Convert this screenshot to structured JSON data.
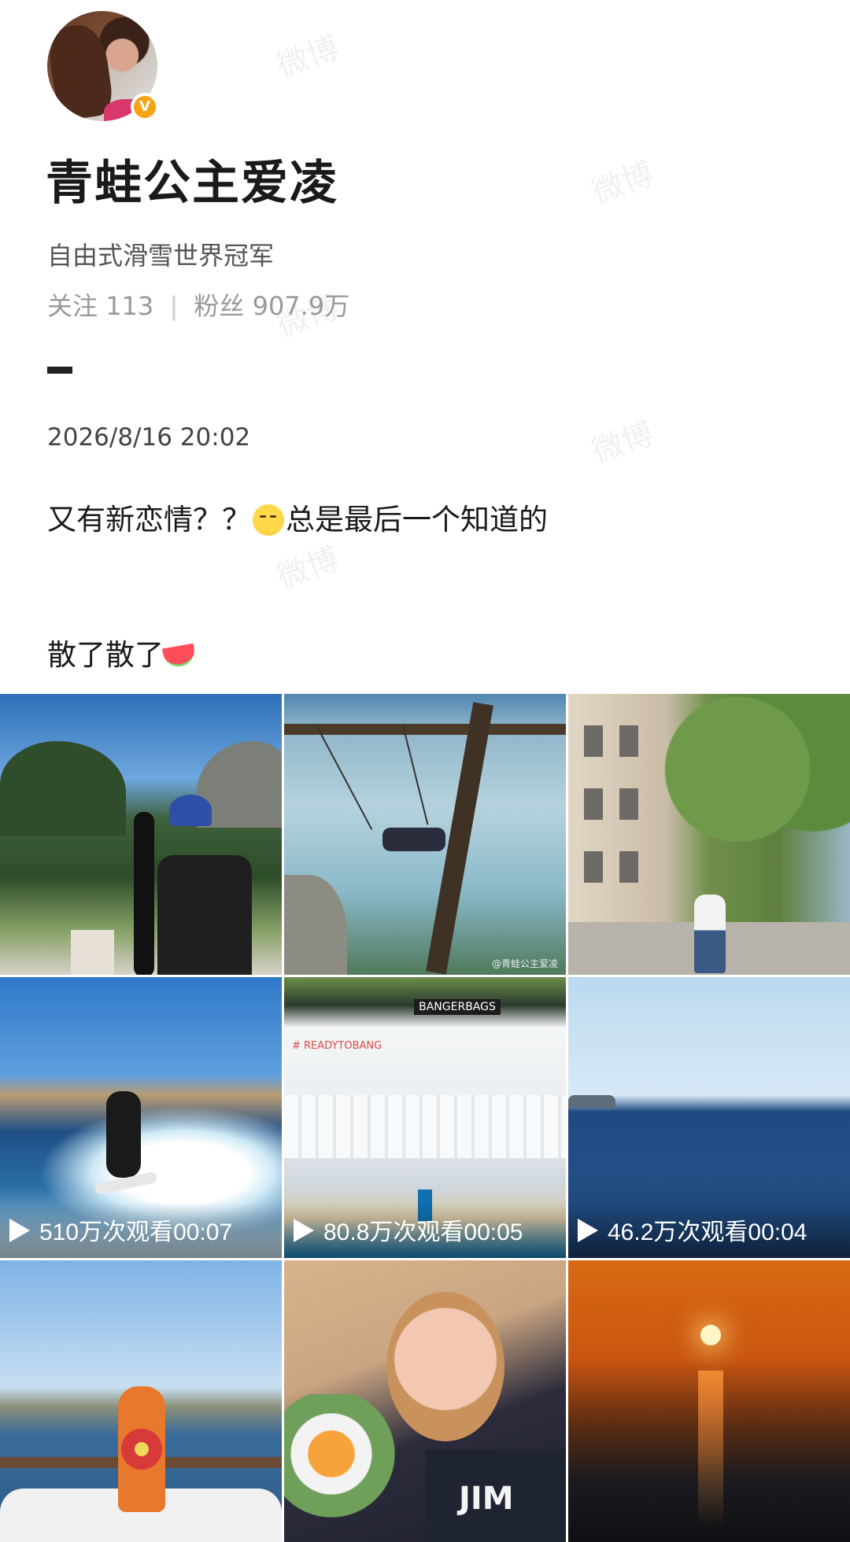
{
  "watermark": "微博",
  "profile": {
    "name": "青蛙公主爱凌",
    "bio": "自由式滑雪世界冠军",
    "following_label": "关注",
    "following_count": "113",
    "followers_label": "粉丝",
    "followers_count": "907.9万"
  },
  "post": {
    "timestamp": "2026/8/16 20:02",
    "line1_a": "又有新恋情？？",
    "line1_b": "总是最后一个知道的",
    "line2": "散了散了",
    "emoji1": "smirk-face-icon",
    "emoji2": "watermelon-icon"
  },
  "media": [
    {
      "kind": "photo",
      "scene": "ski-jump-mountain"
    },
    {
      "kind": "photo",
      "scene": "lake-swing",
      "watermark": "@青蛙公主爱凌"
    },
    {
      "kind": "photo",
      "scene": "paris-street"
    },
    {
      "kind": "video",
      "scene": "wakesurf",
      "views": "510万次观看",
      "duration": "00:07"
    },
    {
      "kind": "video",
      "scene": "airbag-landing",
      "views": "80.8万次观看",
      "duration": "00:05",
      "sign_text": "BANGERBAGS",
      "tag_text": "# READYTOBANG"
    },
    {
      "kind": "video",
      "scene": "open-sea",
      "views": "46.2万次观看",
      "duration": "00:04"
    },
    {
      "kind": "photo",
      "scene": "boat-dress"
    },
    {
      "kind": "photo",
      "scene": "selfie-flowers",
      "shirt_text": "JIM"
    },
    {
      "kind": "photo",
      "scene": "sunset-sea"
    }
  ],
  "colors": {
    "verified_badge": "#f7a313",
    "text_primary": "#1a1a1a",
    "text_secondary": "#555555",
    "text_muted": "#999999"
  }
}
